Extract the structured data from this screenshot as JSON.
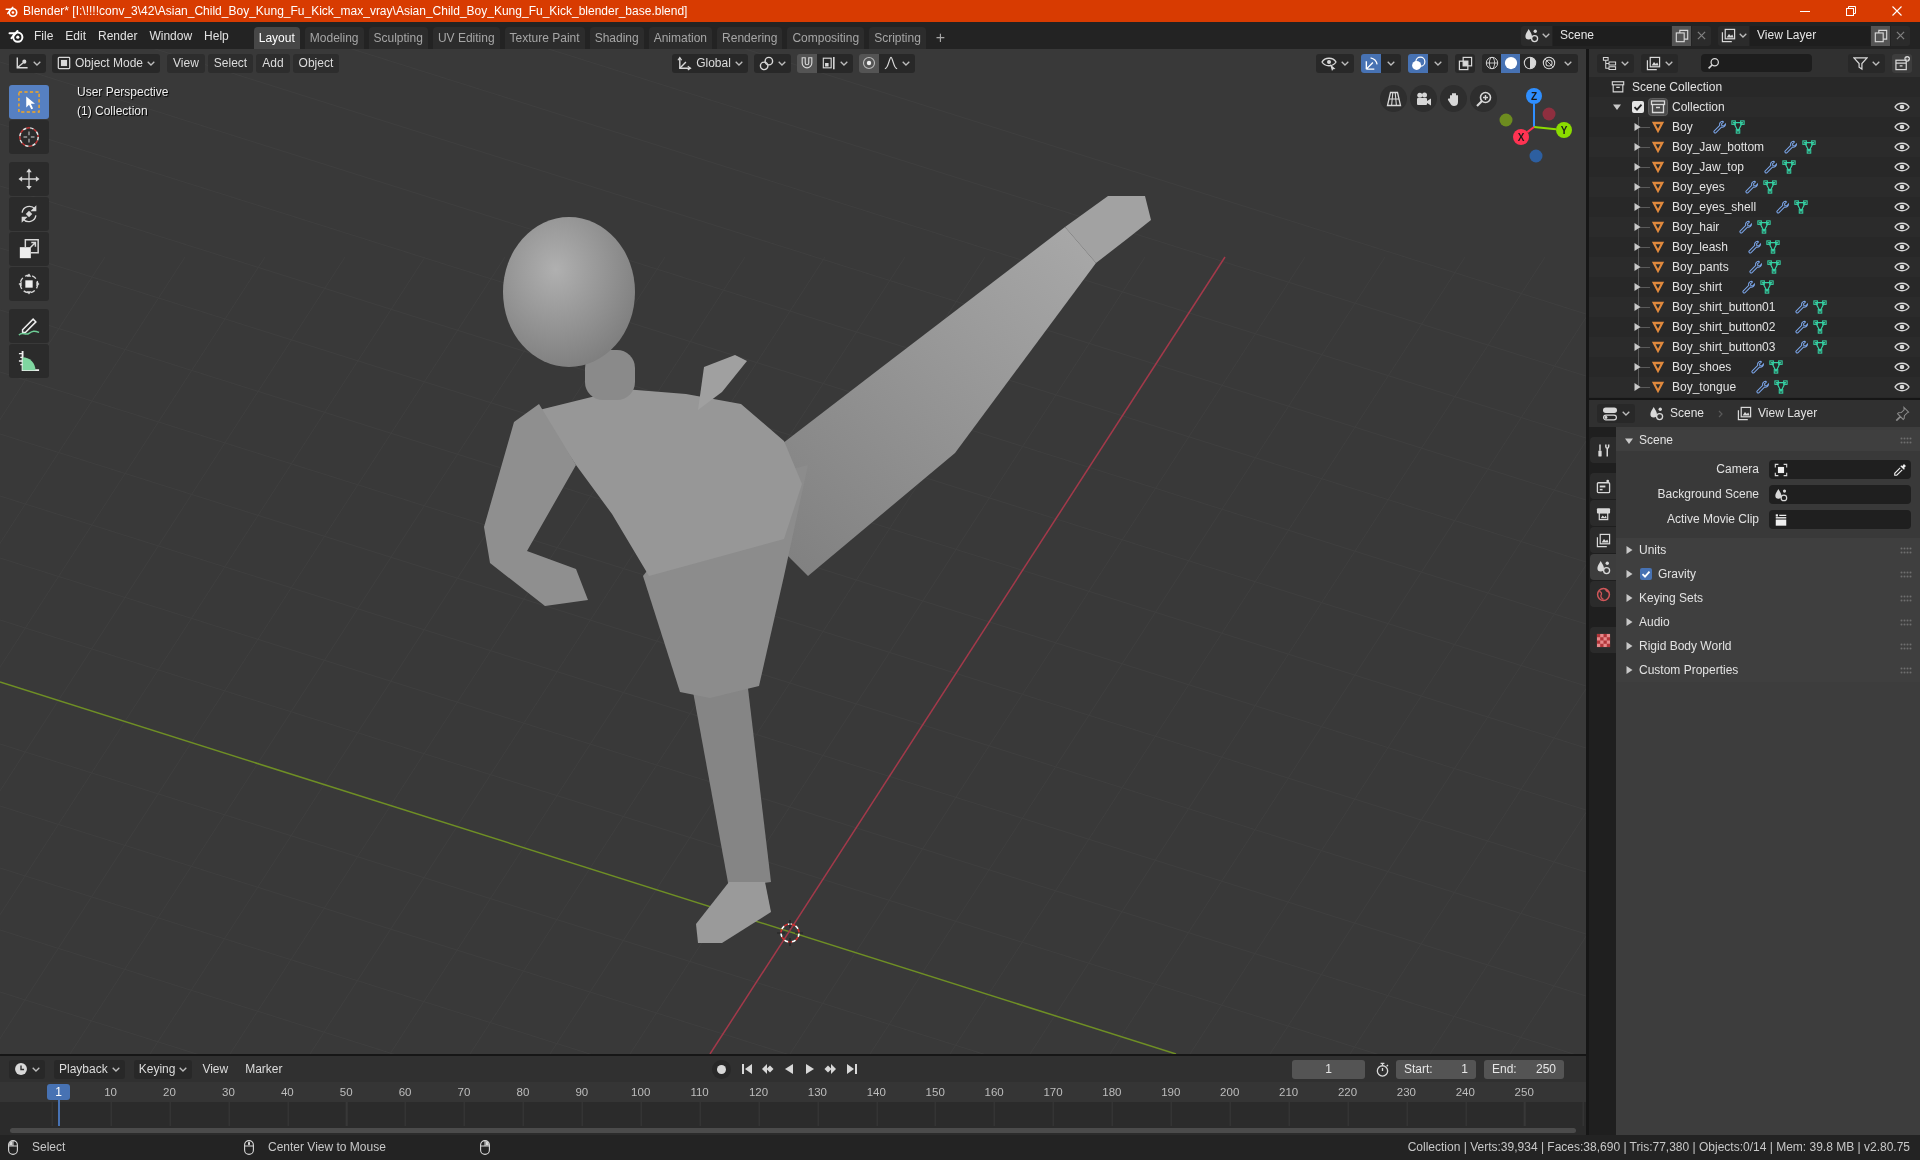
{
  "window": {
    "title": "Blender* [I:\\!!!!conv_3\\42\\Asian_Child_Boy_Kung_Fu_Kick_max_vray\\Asian_Child_Boy_Kung_Fu_Kick_blender_base.blend]"
  },
  "top_bar": {
    "menus": [
      "File",
      "Edit",
      "Render",
      "Window",
      "Help"
    ],
    "workspaces": [
      {
        "label": "Layout",
        "selected": true
      },
      {
        "label": "Modeling",
        "selected": false
      },
      {
        "label": "Sculpting",
        "selected": false
      },
      {
        "label": "UV Editing",
        "selected": false
      },
      {
        "label": "Texture Paint",
        "selected": false
      },
      {
        "label": "Shading",
        "selected": false
      },
      {
        "label": "Animation",
        "selected": false
      },
      {
        "label": "Rendering",
        "selected": false
      },
      {
        "label": "Compositing",
        "selected": false
      },
      {
        "label": "Scripting",
        "selected": false
      }
    ],
    "add_workspace": "+",
    "scene": "Scene",
    "view_layer": "View Layer"
  },
  "viewport": {
    "mode": "Object Mode",
    "menus": [
      "View",
      "Select",
      "Add",
      "Object"
    ],
    "orientation": "Global",
    "center_toggles": [
      {
        "kind": "snap",
        "on": false
      },
      {
        "kind": "proportional",
        "on": false
      }
    ],
    "toggles": [
      {
        "kind": "gizmos",
        "on": true
      },
      {
        "kind": "overlays",
        "on": true
      },
      {
        "kind": "xray",
        "on": false
      }
    ],
    "shading": [
      {
        "kind": "wireframe",
        "selected": false
      },
      {
        "kind": "solid",
        "selected": true
      },
      {
        "kind": "material",
        "selected": false
      },
      {
        "kind": "rendered",
        "selected": false
      }
    ],
    "tool_groups": [
      [
        {
          "kind": "select-box",
          "selected": true
        },
        {
          "kind": "cursor",
          "selected": false
        }
      ],
      [
        {
          "kind": "move",
          "selected": false
        },
        {
          "kind": "rotate",
          "selected": false
        },
        {
          "kind": "scale",
          "selected": false
        },
        {
          "kind": "transform",
          "selected": false
        }
      ],
      [
        {
          "kind": "annotate",
          "selected": false
        },
        {
          "kind": "measure",
          "selected": false
        }
      ]
    ],
    "overlay_text": [
      "User Perspective",
      "(1) Collection"
    ],
    "gizmo_axes": [
      "X",
      "Y",
      "Z"
    ]
  },
  "outliner": {
    "root": "Scene Collection",
    "collections": [
      {
        "name": "Collection",
        "checked": true,
        "active": true,
        "expanded": true,
        "children": [
          {
            "name": "Boy",
            "expanded": false
          },
          {
            "name": "Boy_Jaw_bottom",
            "expanded": false
          },
          {
            "name": "Boy_Jaw_top",
            "expanded": false
          },
          {
            "name": "Boy_eyes",
            "expanded": false
          },
          {
            "name": "Boy_eyes_shell",
            "expanded": false
          },
          {
            "name": "Boy_hair",
            "expanded": false
          },
          {
            "name": "Boy_leash",
            "expanded": false
          },
          {
            "name": "Boy_pants",
            "expanded": false
          },
          {
            "name": "Boy_shirt",
            "expanded": false
          },
          {
            "name": "Boy_shirt_button01",
            "expanded": false
          },
          {
            "name": "Boy_shirt_button02",
            "expanded": false
          },
          {
            "name": "Boy_shirt_button03",
            "expanded": false
          },
          {
            "name": "Boy_shoes",
            "expanded": false
          },
          {
            "name": "Boy_tongue",
            "expanded": false
          }
        ]
      }
    ]
  },
  "properties": {
    "breadcrumb": [
      "Scene",
      "View Layer"
    ],
    "tab_groups": [
      [
        {
          "kind": "tool",
          "selected": false
        }
      ],
      [
        {
          "kind": "render",
          "selected": false
        },
        {
          "kind": "output",
          "selected": false
        },
        {
          "kind": "view-layer",
          "selected": false
        },
        {
          "kind": "scene",
          "selected": true
        },
        {
          "kind": "world",
          "selected": false
        }
      ],
      [
        {
          "kind": "texture",
          "selected": false
        }
      ]
    ],
    "panels": [
      {
        "kind": "plain",
        "title": "Scene",
        "expanded": true,
        "fields": [
          {
            "kind": "camera",
            "label": "Camera"
          },
          {
            "kind": "scene",
            "label": "Background Scene"
          },
          {
            "kind": "clip",
            "label": "Active Movie Clip"
          }
        ]
      },
      {
        "kind": "plain",
        "title": "Units",
        "expanded": false
      },
      {
        "kind": "toggle",
        "title": "Gravity",
        "expanded": false,
        "checked": true
      },
      {
        "kind": "plain",
        "title": "Keying Sets",
        "expanded": false
      },
      {
        "kind": "plain",
        "title": "Audio",
        "expanded": false
      },
      {
        "kind": "plain",
        "title": "Rigid Body World",
        "expanded": false
      },
      {
        "kind": "plain",
        "title": "Custom Properties",
        "expanded": false
      }
    ]
  },
  "timeline": {
    "menus": [
      {
        "kind": "dropdown",
        "label": "Playback"
      },
      {
        "kind": "dropdown",
        "label": "Keying"
      },
      {
        "kind": "menu",
        "label": "View"
      },
      {
        "kind": "menu",
        "label": "Marker"
      }
    ],
    "current_frame": "1",
    "start_label": "Start:",
    "start": "1",
    "end_label": "End:",
    "end": "250",
    "playhead": "1",
    "ruler": [
      "10",
      "20",
      "30",
      "40",
      "50",
      "60",
      "70",
      "80",
      "90",
      "100",
      "110",
      "120",
      "130",
      "140",
      "150",
      "160",
      "170",
      "180",
      "190",
      "200",
      "210",
      "220",
      "230",
      "240",
      "250"
    ]
  },
  "status_bar": {
    "hints": [
      {
        "kind": "left-click",
        "label": "Select"
      },
      {
        "kind": "middle-click",
        "label": "Center View to Mouse"
      },
      {
        "kind": "right-click"
      }
    ],
    "stats": "Collection | Verts:39,934 | Faces:38,690 | Tris:77,380 | Objects:0/14 | Mem: 39.8 MB | v2.80.75"
  }
}
